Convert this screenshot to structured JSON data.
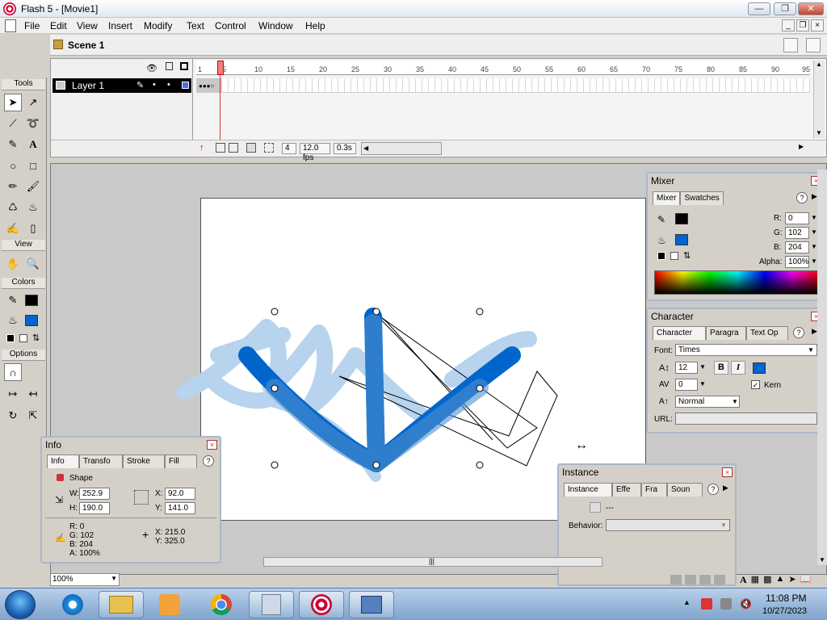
{
  "window": {
    "title": "Flash 5 - [Movie1]"
  },
  "menu": [
    "File",
    "Edit",
    "View",
    "Insert",
    "Modify",
    "Text",
    "Control",
    "Window",
    "Help"
  ],
  "scene": {
    "label": "Scene 1"
  },
  "tools": {
    "title": "Tools",
    "view_label": "View",
    "colors_label": "Colors",
    "options_label": "Options"
  },
  "timeline": {
    "layer_name": "Layer 1",
    "ruler_ticks": [
      "1",
      "5",
      "10",
      "15",
      "20",
      "25",
      "30",
      "35",
      "40",
      "45",
      "50",
      "55",
      "60",
      "65",
      "70",
      "75",
      "80",
      "85",
      "90",
      "95"
    ],
    "current_frame": "4",
    "fps": "12.0 fps",
    "elapsed": "0.3s"
  },
  "mixer": {
    "title": "Mixer",
    "tab_mixer": "Mixer",
    "tab_swatches": "Swatches",
    "r_label": "R:",
    "r_value": "0",
    "g_label": "G:",
    "g_value": "102",
    "b_label": "B:",
    "b_value": "204",
    "alpha_label": "Alpha:",
    "alpha_value": "100%"
  },
  "character": {
    "title": "Character",
    "tab_character": "Character",
    "tab_paragraph": "Paragra",
    "tab_text_options": "Text Op",
    "font_label": "Font:",
    "font_value": "Times",
    "size_value": "12",
    "tracking_value": "0",
    "kern_label": "Kern",
    "baseline_value": "Normal",
    "url_label": "URL:",
    "bold": "B",
    "italic": "I"
  },
  "info": {
    "title": "Info",
    "tab_info": "Info",
    "tab_transform": "Transfo",
    "tab_stroke": "Stroke",
    "tab_fill": "Fill",
    "shape_label": "Shape",
    "w_label": "W:",
    "w_value": "252.9",
    "h_label": "H:",
    "h_value": "190.0",
    "x_label": "X:",
    "x_value": "92.0",
    "y_label": "Y:",
    "y_value": "141.0",
    "r_line": "R: 0",
    "g_line": "G: 102",
    "b_line": "B: 204",
    "a_line": "A: 100%",
    "cursor_x": "X:  215.0",
    "cursor_y": "Y:  325.0"
  },
  "instance": {
    "title": "Instance",
    "tab_instance": "Instance",
    "tab_effect": "Effe",
    "tab_frame": "Fra",
    "tab_sound": "Soun",
    "dashes": "---",
    "behavior_label": "Behavior:"
  },
  "zoom": {
    "value": "100%"
  },
  "taskbar": {
    "time": "11:08 PM",
    "date": "10/27/2023"
  },
  "colors": {
    "stroke": "#000000",
    "fill": "#0066cc",
    "light_brush": "#b7d3ee"
  }
}
